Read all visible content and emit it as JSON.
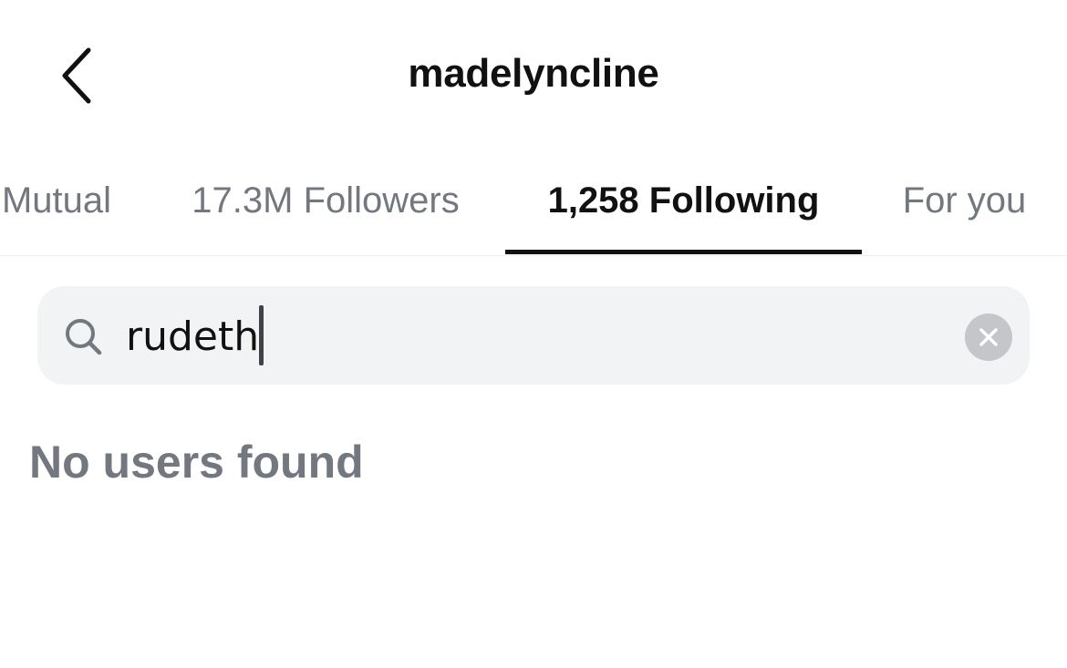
{
  "header": {
    "title": "madelyncline",
    "back_icon": "chevron-left-icon"
  },
  "tabs": [
    {
      "label": "Mutual",
      "active": false
    },
    {
      "label": "17.3M Followers",
      "active": false
    },
    {
      "label": "1,258 Following",
      "active": true
    },
    {
      "label": "For you",
      "active": false
    }
  ],
  "search": {
    "value": "rudeth",
    "icon": "search-icon",
    "clear_icon": "clear-icon"
  },
  "results": {
    "empty_message": "No users found"
  },
  "colors": {
    "text_primary": "#111111",
    "text_secondary": "#737880",
    "search_bg": "#f2f3f5",
    "clear_bg": "#c4c6ca"
  }
}
